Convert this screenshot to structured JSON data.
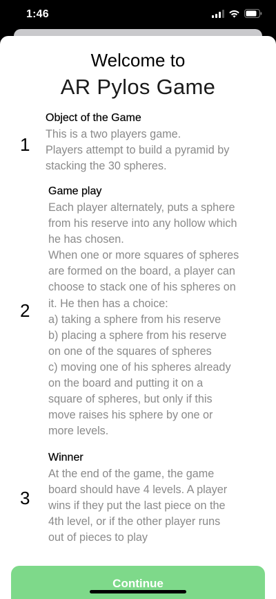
{
  "status_bar": {
    "time": "1:46",
    "icons": [
      "signal-icon",
      "wifi-icon",
      "battery-icon"
    ]
  },
  "title": {
    "line1": "Welcome to",
    "line2": "AR Pylos Game"
  },
  "sections": [
    {
      "number": "1",
      "title": "Object of the Game",
      "lines": [
        "This is a two players game.",
        "Players attempt to build a pyramid by",
        "stacking the 30 spheres."
      ]
    },
    {
      "number": "2",
      "title": "Game play",
      "lines": [
        "Each player alternately, puts a sphere",
        "from his reserve into any hollow which",
        "he has chosen.",
        "When one or more squares of spheres",
        "are formed on the board, a player can",
        "choose to stack one of his spheres on",
        "it. He then has a choice:",
        "a) taking a sphere from his reserve",
        "b) placing a sphere from his reserve",
        "on one of the squares of spheres",
        "c) moving one of his spheres already",
        "on the board and putting it on a",
        "square of spheres, but only if this",
        "move raises his sphere by one or",
        "more levels."
      ]
    },
    {
      "number": "3",
      "title": "Winner",
      "lines": [
        "At the end of the game, the game",
        "board should have 4 levels. A player",
        "wins if they put the last piece on the",
        "4th level, or if the other player runs",
        "out of pieces to play"
      ]
    }
  ],
  "continue_label": "Continue",
  "colors": {
    "accent_green": "#7ed98a",
    "body_text": "#8a8a8a"
  }
}
